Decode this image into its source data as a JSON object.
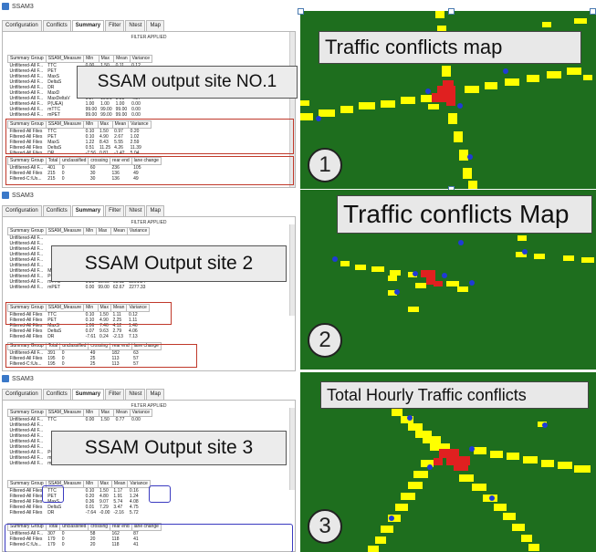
{
  "tabs": [
    "Configuration",
    "Conflicts",
    "Summary",
    "Filter",
    "Ntest",
    "Map"
  ],
  "filter_label": "FILTER APPLIED",
  "panel1": {
    "window_title": "SSAM3",
    "overlay": "SSAM output site NO.1",
    "measures_header": [
      "Summary Group",
      "SSAM_Measure",
      "Min",
      "Max",
      "Mean",
      "Variance"
    ],
    "unfiltered_rows": [
      [
        "Unfiltered-All F...",
        "TTC",
        "0.00",
        "1.50",
        "0.11",
        "0.12"
      ],
      [
        "Unfiltered-All F...",
        "PET",
        "",
        "",
        "",
        ""
      ],
      [
        "Unfiltered-All F...",
        "MaxS",
        "",
        "",
        "",
        ""
      ],
      [
        "Unfiltered-All F...",
        "DeltaS",
        "",
        "",
        "",
        ""
      ],
      [
        "Unfiltered-All F...",
        "DR",
        "",
        "",
        "",
        ""
      ],
      [
        "Unfiltered-All F...",
        "MaxD",
        "",
        "",
        "",
        ""
      ],
      [
        "Unfiltered-All F...",
        "MaxDeltaV",
        "0.27",
        "10.21",
        "3.58",
        "4.87"
      ],
      [
        "Unfiltered-All F...",
        "P(UEA)",
        "1.00",
        "1.00",
        "1.00",
        "0.00"
      ],
      [
        "Unfiltered-All F...",
        "mTTC",
        "99.00",
        "99.00",
        "99.00",
        "0.00"
      ],
      [
        "Unfiltered-All F...",
        "mPET",
        "99.00",
        "99.00",
        "99.00",
        "0.00"
      ]
    ],
    "filtered_header": [
      "Summary Group",
      "SSAM_Measure",
      "Min",
      "Max",
      "Mean",
      "Variance"
    ],
    "filtered_rows": [
      [
        "Filtered-All Files",
        "TTC",
        "0.10",
        "1.50",
        "0.97",
        "0.20"
      ],
      [
        "Filtered-All Files",
        "PET",
        "0.10",
        "4.90",
        "2.67",
        "1.02"
      ],
      [
        "Filtered-All Files",
        "MaxS",
        "1.22",
        "8.43",
        "5.55",
        "2.59"
      ],
      [
        "Filtered-All Files",
        "DeltaS",
        "0.51",
        "11.25",
        "4.26",
        "11.39"
      ],
      [
        "Filtered-All Files",
        "DR",
        "-7.56",
        "0.81",
        "-1.42",
        "5.04"
      ]
    ],
    "totals_header": [
      "Summary Group",
      "Total",
      "unclassified",
      "crossing",
      "rear end",
      "lane change"
    ],
    "totals_rows": [
      [
        "Unfiltered-All F...",
        "401",
        "0",
        "60",
        "236",
        "105"
      ],
      [
        "Filtered-All Files",
        "215",
        "0",
        "30",
        "136",
        "49"
      ],
      [
        "Filtered-C:\\Us...",
        "215",
        "0",
        "30",
        "136",
        "49"
      ]
    ]
  },
  "panel2": {
    "window_title": "SSAM3",
    "overlay": "SSAM Output site 2",
    "measures_header": [
      "Summary Group",
      "SSAM_Measure",
      "Min",
      "Max",
      "Mean",
      "Variance"
    ],
    "unfiltered_rows": [
      [
        "Unfiltered-All F...",
        "",
        "",
        "",
        "",
        ""
      ],
      [
        "Unfiltered-All F...",
        "",
        "",
        "",
        "",
        ""
      ],
      [
        "Unfiltered-All F...",
        "",
        "",
        "",
        "",
        ""
      ],
      [
        "Unfiltered-All F...",
        "",
        "",
        "",
        "",
        ""
      ],
      [
        "Unfiltered-All F...",
        "",
        "",
        "",
        "",
        ""
      ],
      [
        "Unfiltered-All F...",
        "",
        "",
        "",
        "",
        ""
      ],
      [
        "Unfiltered-All F...",
        "MaxDeltaV",
        "0.04",
        "6.35",
        "2.33",
        "2.76"
      ],
      [
        "Unfiltered-All F...",
        "P(UEA)",
        "0.00",
        "1.00",
        "0.30",
        "0.15"
      ],
      [
        "Unfiltered-All F...",
        "mTTC",
        "0.20",
        "99.00",
        "65.11",
        "2201.24"
      ],
      [
        "Unfiltered-All F...",
        "mPET",
        "0.00",
        "99.00",
        "62.67",
        "2277.33"
      ]
    ],
    "filtered_rows": [
      [
        "Filtered-All Files",
        "TTC",
        "0.10",
        "1.50",
        "1.11",
        "0.12"
      ],
      [
        "Filtered-All Files",
        "PET",
        "0.10",
        "4.90",
        "2.25",
        "1.11"
      ],
      [
        "Filtered-All Files",
        "MaxS",
        "1.06",
        "7.46",
        "4.12",
        "1.46"
      ],
      [
        "Filtered-All Files",
        "DeltaS",
        "0.07",
        "9.63",
        "2.79",
        "4.06"
      ],
      [
        "Filtered-All Files",
        "DR",
        "-7.61",
        "0.24",
        "-2.13",
        "7.13"
      ]
    ],
    "totals_rows": [
      [
        "Unfiltered-All F...",
        "391",
        "0",
        "49",
        "182",
        "63"
      ],
      [
        "Filtered-All Files",
        "195",
        "0",
        "25",
        "113",
        "57"
      ],
      [
        "Filtered-C:\\Us...",
        "195",
        "0",
        "25",
        "113",
        "57"
      ]
    ]
  },
  "panel3": {
    "window_title": "SSAM3",
    "overlay": "SSAM Output  site 3",
    "measures_header": [
      "Summary Group",
      "SSAM_Measure",
      "Min",
      "Max",
      "Mean",
      "Variance"
    ],
    "unfiltered_rows": [
      [
        "Unfiltered-All F...",
        "TTC",
        "0.00",
        "1.50",
        "0.77",
        "0.00"
      ],
      [
        "Unfiltered-All F...",
        "",
        "",
        "",
        "",
        ""
      ],
      [
        "Unfiltered-All F...",
        "",
        "",
        "",
        "",
        ""
      ],
      [
        "Unfiltered-All F...",
        "",
        "",
        "",
        "",
        ""
      ],
      [
        "Unfiltered-All F...",
        "",
        "",
        "",
        "",
        ""
      ],
      [
        "Unfiltered-All F...",
        "",
        "",
        "",
        "",
        ""
      ],
      [
        "Unfiltered-All F...",
        "P(UEA)",
        "1.00",
        "1.00",
        "1.00",
        "0.00"
      ],
      [
        "Unfiltered-All F...",
        "mTTC",
        "99.00",
        "99.00",
        "99.00",
        "0.00"
      ],
      [
        "Unfiltered-All F...",
        "mPET",
        "99.00",
        "99.00",
        "99.00",
        "0.00"
      ]
    ],
    "filtered_rows": [
      [
        "Filtered-All Files",
        "TTC",
        "0.10",
        "1.50",
        "1.17",
        "0.16"
      ],
      [
        "Filtered-All Files",
        "PET",
        "0.20",
        "4.80",
        "1.91",
        "1.24"
      ],
      [
        "Filtered-All Files",
        "MaxS",
        "0.36",
        "9.07",
        "5.74",
        "4.08"
      ],
      [
        "Filtered-All Files",
        "DeltaS",
        "0.01",
        "7.29",
        "3.47",
        "4.75"
      ],
      [
        "Filtered-All Files",
        "DR",
        "-7.64",
        "-0.00",
        "-2.16",
        "5.72"
      ]
    ],
    "totals_rows": [
      [
        "Unfiltered-All F...",
        "307",
        "0",
        "58",
        "162",
        "87"
      ],
      [
        "Filtered-All Files",
        "179",
        "0",
        "20",
        "118",
        "41"
      ],
      [
        "Filtered-C:\\Us...",
        "179",
        "0",
        "20",
        "118",
        "41"
      ]
    ]
  },
  "maps": [
    {
      "title": "Traffic conflicts map",
      "number": "1"
    },
    {
      "title": "Traffic conflicts Map",
      "number": "2"
    },
    {
      "title": "Total Hourly Traffic conflicts",
      "number": "3"
    }
  ]
}
